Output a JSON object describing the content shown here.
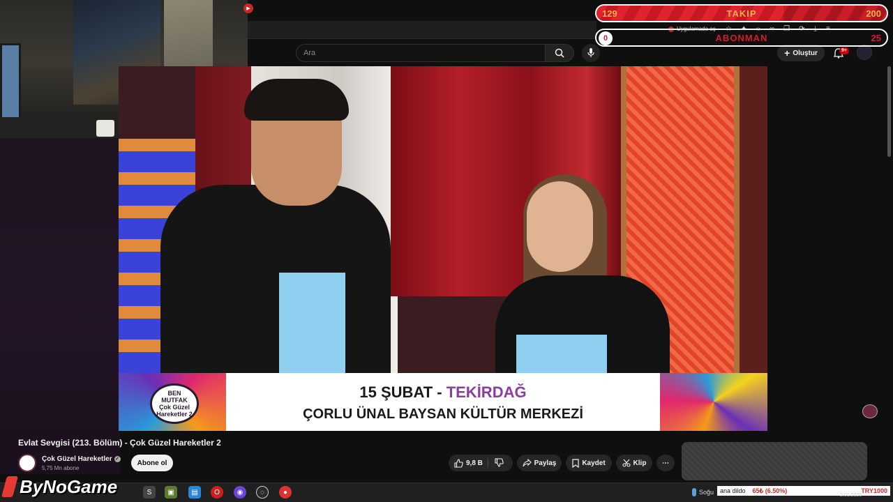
{
  "webcam": {
    "label": ""
  },
  "browser": {
    "app_hint": "Uygulamada aç",
    "icons": [
      "star-icon",
      "puzzle-icon",
      "code-icon",
      "link-icon",
      "copy-icon",
      "sync-icon",
      "download-icon",
      "split-icon",
      "account-icon"
    ]
  },
  "youtube": {
    "search_placeholder": "Ara",
    "create_label": "Oluştur",
    "notifications_badge": "9+",
    "video_title": "Evlat Sevgisi (213. Bölüm) - Çok Güzel Hareketler 2",
    "channel_name": "Çok Güzel Hareketler",
    "channel_subs": "5,75 Mn abone",
    "subscribe_label": "Abone ol",
    "like_count": "9,8 B",
    "share_label": "Paylaş",
    "save_label": "Kaydet",
    "clip_label": "Klip",
    "more_label": "⋯"
  },
  "video_frame": {
    "banner_line1_date": "15 ŞUBAT - ",
    "banner_line1_place": "TEKİRDAĞ",
    "banner_line2": "ÇORLU ÜNAL BAYSAN KÜLTÜR MERKEZİ",
    "logo_text": "BEN MUTFAK Çok Güzel Hareketler 2"
  },
  "overlays": {
    "follow": {
      "current": "129",
      "label": "TAKIP",
      "goal": "200",
      "progress": 0.645
    },
    "subs": {
      "current": "0",
      "label": "ABONMAN",
      "goal": "25",
      "progress": 0.0
    }
  },
  "taskbar": {
    "brand": "ByNoGame",
    "apps": [
      "windows-icon",
      "chrome-icon",
      "obs-icon",
      "files-icon",
      "store-icon",
      "opera-icon",
      "discord-icon",
      "steam-icon",
      "chrome-profile-icon"
    ],
    "weather_text": "Soğu",
    "ticker": {
      "text": "ana dildo",
      "change": "65₺ (6.50%)",
      "currency": "TRY1000"
    },
    "date": "2.01.2026"
  },
  "colors": {
    "accent": "#cc0000",
    "overlay_red": "#c81e28",
    "overlay_text": "#ffb14a"
  }
}
